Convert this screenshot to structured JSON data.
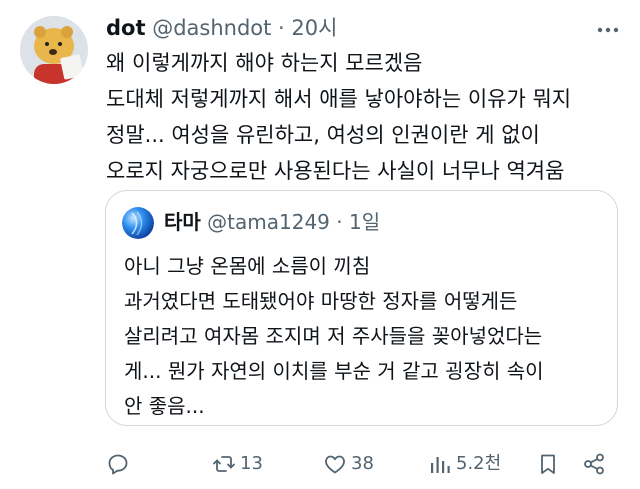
{
  "post": {
    "author_name": "dot",
    "author_handle": "@dashndot",
    "separator": "·",
    "time": "20시",
    "text": "왜 이렇게까지 해야 하는지 모르겠음\n도대체 저렇게까지 해서 애를 낳아야하는 이유가 뭐지\n정말... 여성을 유린하고, 여성의 인권이란 게 없이\n오로지 자궁으로만 사용된다는 사실이 너무나 역겨움"
  },
  "quote": {
    "author_name": "타마",
    "author_handle": "@tama1249",
    "separator": "·",
    "time": "1일",
    "text": "아니 그냥 온몸에 소름이 끼침\n과거였다면 도태됐어야 마땅한 정자를 어떻게든\n살리려고 여자몸 조지며 저 주사들을 꽂아넣었다는\n게... 뭔가 자연의 이치를 부순 거 같고 굉장히 속이\n안 좋음..."
  },
  "actions": {
    "replies_icon": "reply-icon",
    "retweet_count": "13",
    "like_count": "38",
    "view_count": "5.2천",
    "bookmark_icon": "bookmark-icon",
    "share_icon": "share-icon"
  },
  "colors": {
    "text": "#0f1419",
    "secondary": "#536471",
    "border": "#cfd9de"
  }
}
